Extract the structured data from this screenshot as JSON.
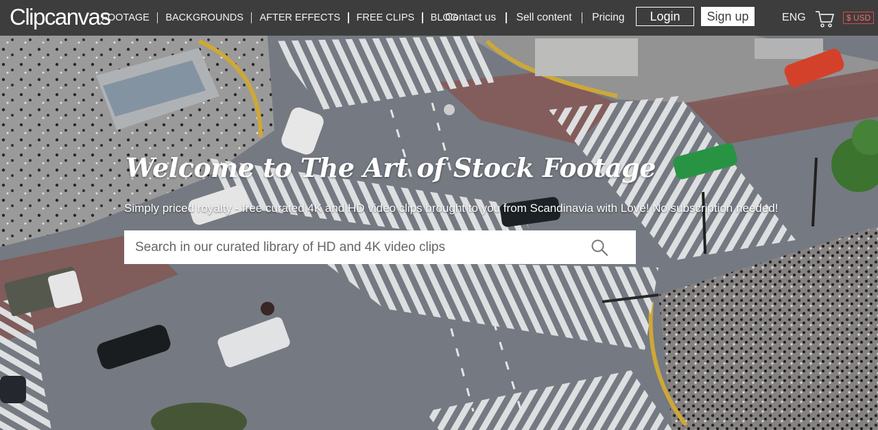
{
  "brand": {
    "logo_text": "Clipcanvas"
  },
  "nav": {
    "primary": [
      {
        "label": "FOOTAGE"
      },
      {
        "label": "BACKGROUNDS"
      },
      {
        "label": "AFTER EFFECTS"
      },
      {
        "label": "FREE CLIPS"
      },
      {
        "label": "BLOG"
      }
    ],
    "secondary": [
      {
        "label": "Contact us"
      },
      {
        "label": "Sell content"
      },
      {
        "label": "Pricing"
      }
    ],
    "login_label": "Login",
    "signup_label": "Sign up",
    "language": "ENG",
    "currency": "$ USD",
    "cart_icon": "shopping-cart-icon"
  },
  "hero": {
    "headline": "Welcome to The Art of Stock Footage",
    "subline": "Simply priced royalty - free curated 4K and HD video clips brought to you from Scandinavia with Love! No subscription needed!",
    "search": {
      "placeholder": "Search in our curated library of HD and 4K video clips",
      "value": "",
      "icon": "search-icon"
    }
  },
  "colors": {
    "topbar_bg": "#3d3d3d",
    "text_light": "#ffffff",
    "currency_accent": "#e04848"
  }
}
